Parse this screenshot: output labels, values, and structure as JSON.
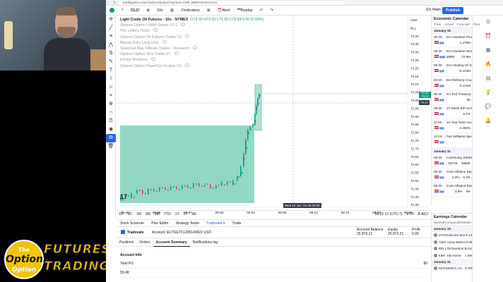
{
  "browser": {
    "url": "tradingview.com/chart/y1sbzaoo/?symbol=CME_MINI%3AES1%21"
  },
  "toolbar": {
    "symbol": "CL1!",
    "interval": "10s",
    "indicators_label": "Indicators",
    "alert_label": "Alert",
    "replay_label": "Replay",
    "market_label": "ES Main",
    "publish_label": "Publish"
  },
  "chart": {
    "title": "Light Crude Oil Futures · 10s · NYMEX",
    "ohlc": "O73.33 H73.33 L73.33 C73.33 0.00 (0.00%)",
    "indicators": [
      "Options Option VWAP Sniper V1.1",
      "The Lottery Ticket",
      "Options Option Oil Futures Trader V1",
      "Bitcoin Daily Long Only",
      "Seasonal Bias Filtered Trades - Research",
      "Options Option Tera Trader V1",
      "Ed Bar Breakout",
      "Options Option PaperCut Scalper V1"
    ],
    "y_ticks": [
      "USD",
      "BLL",
      "73.40",
      "73.35",
      "73.30",
      "73.25",
      "73.20",
      "73.15",
      "73.10",
      "73.05",
      "73.00",
      "72.95",
      "72.90",
      "72.85",
      "72.80",
      "72.75",
      "72.70",
      "72.65",
      "72.60",
      "72.55",
      "72.50",
      "72.45",
      "72.40",
      "72.35"
    ],
    "x_ticks": [
      "05:40",
      "05:45",
      "05:50",
      "05:55",
      "06:00",
      "06:05",
      "06:10",
      "06:15",
      "06:20",
      "06:25"
    ],
    "current_price": "73.33",
    "current_price_sub": "73.27",
    "cross_price": "73.27",
    "cross_time": "Wed 10 Jan '24  06:00:50"
  },
  "ranges": [
    "1D",
    "5D",
    "1M",
    "3M",
    "6M",
    "YTD",
    "1Y",
    "5Y",
    "All"
  ],
  "status": {
    "time": "06:01:12 (UTC-7)",
    "eth": "ETH",
    "badj": "B-ADJ"
  },
  "bottom": {
    "tabs": [
      "Stock Screener",
      "Pine Editor",
      "Strategy Tester",
      "Tradovate ▾",
      "Trade"
    ],
    "broker": "Tradovate",
    "account": "Account: ELITEETF1305140022 USD",
    "balance_label": "Account Balance",
    "balance": "25 873.21",
    "equity_label": "Equity",
    "equity": "25 873.21",
    "profit_label": "Profit",
    "profit": "0.00",
    "subtabs": [
      "Positions",
      "Orders",
      "Account Summary",
      "Notifications log"
    ],
    "info_title": "Account Info",
    "rows": [
      {
        "label": "Total P/L",
        "value": "$0"
      },
      {
        "label": "55.48",
        "value": ""
      }
    ]
  },
  "calendar": {
    "title": "Economic Calendar",
    "cols": [
      "Time",
      "Actual",
      "Forecast",
      "Prior"
    ],
    "day1": "January 10",
    "events": [
      {
        "time": "06:30",
        "name": "EIA Gasoline Production",
        "a": "",
        "f": "",
        "p": "-1.275M"
      },
      {
        "time": "06:30",
        "name": "EIA Gasoline Stocks Change",
        "a": "2.489M",
        "f": "",
        "p": "10.9M"
      },
      {
        "time": "06:30",
        "name": "EIA Heating Oil Stocks Change",
        "a": "",
        "f": "",
        "p": "-0.433M"
      },
      {
        "time": "06:30",
        "name": "EIA Refinery Crude Runs",
        "a": "",
        "f": "",
        "p": "0.121M"
      },
      {
        "time": "06:30",
        "name": "NY Fed Treasury Purchases",
        "a": "",
        "f": "",
        "p": "80"
      },
      {
        "time": "09:30",
        "name": "17-Week Bill Auction",
        "a": "",
        "f": "",
        "p": "5.2%"
      },
      {
        "time": "11:00",
        "name": "10-Year Note Auction",
        "a": "",
        "f": "",
        "p": "4.296%"
      },
      {
        "time": "13:15",
        "name": "Fed Williams Speech",
        "a": "",
        "f": "",
        "p": ""
      }
    ],
    "day2": "January 11",
    "events2": [
      {
        "time": "06:30",
        "name": "Continuing Jobless Claims",
        "a": "",
        "f": "1871K",
        "p": "1855K"
      },
      {
        "time": "06:30",
        "name": "Core Inflation Rate MoM",
        "a": "",
        "f": "0.3%",
        "p": "0.3%"
      },
      {
        "time": "06:30",
        "name": "Core Inflation Rate YoY",
        "a": "",
        "f": "3.8%",
        "p": "4%"
      }
    ]
  },
  "earnings": {
    "title": "Earnings Calendar",
    "cols": [
      "Symbol",
      "Company",
      "Estimate"
    ],
    "day1": "January 10",
    "rows": [
      {
        "sym": "LFCR",
        "co": "Lifecore Biomedical",
        "est": "-0.13"
      },
      {
        "sym": "ANIX",
        "co": "Anixa Biosciences",
        "est": "-0.09"
      },
      {
        "sym": "RELL",
        "co": "Richardson Electronics",
        "est": "0.01"
      },
      {
        "sym": "KBH",
        "co": "KB Home",
        "est": "1.696"
      }
    ],
    "day2": "January 11",
    "rows2": [
      {
        "sym": "WAFD",
        "co": "WaFd, Inc",
        "est": "0.768"
      }
    ]
  },
  "branding": {
    "line1": "The",
    "line2": "Options",
    "line3": "Option",
    "word1": "FUTURES",
    "word2": "TRADING"
  },
  "colors": {
    "accent": "#2962ff",
    "up": "#089981",
    "down": "#f23645",
    "highlight": "#6ec9b0"
  }
}
